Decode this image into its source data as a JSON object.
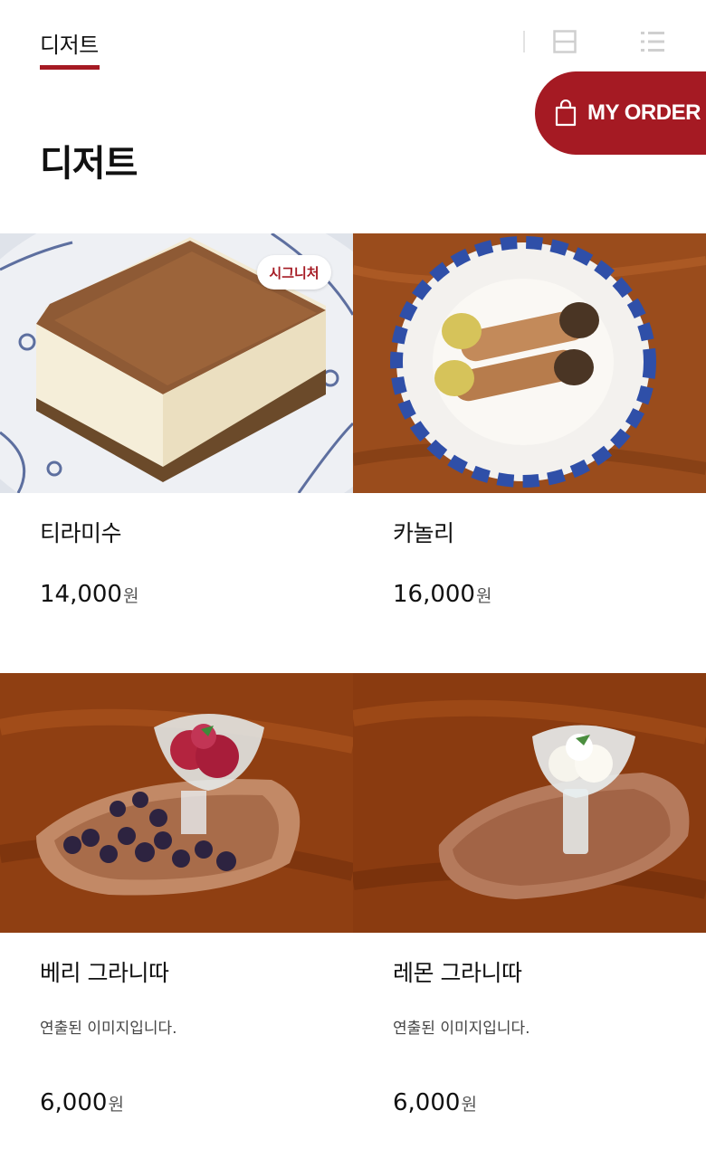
{
  "header": {
    "tab_label": "디저트",
    "view_modes": [
      "single-view-icon",
      "grid-view-icon",
      "list-view-icon"
    ],
    "active_view": "grid"
  },
  "order_button": {
    "label": "MY ORDER"
  },
  "page_title": "디저트",
  "colors": {
    "accent": "#a51a23"
  },
  "items": [
    {
      "name": "티라미수",
      "badge": "시그니처",
      "price": "14,000",
      "currency": "원",
      "description": ""
    },
    {
      "name": "카놀리",
      "badge": "",
      "price": "16,000",
      "currency": "원",
      "description": ""
    },
    {
      "name": "베리 그라니따",
      "badge": "",
      "price": "6,000",
      "currency": "원",
      "description": "연출된 이미지입니다."
    },
    {
      "name": "레몬 그라니따",
      "badge": "",
      "price": "6,000",
      "currency": "원",
      "description": "연출된 이미지입니다."
    }
  ]
}
